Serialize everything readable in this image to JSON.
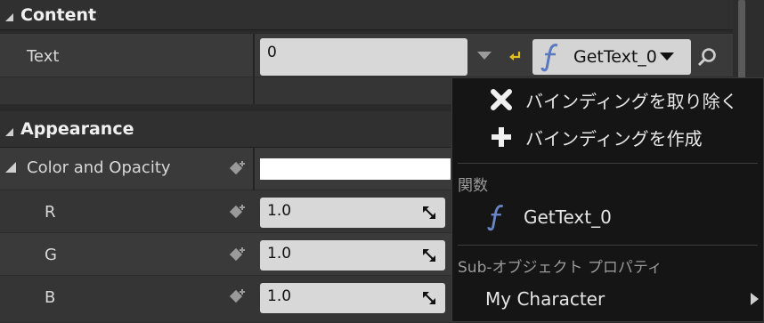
{
  "content": {
    "header": "Content",
    "text_row": {
      "label": "Text",
      "value": "0",
      "binding_button_label": "GetText_0"
    }
  },
  "appearance": {
    "header": "Appearance",
    "color_row": {
      "label": "Color and Opacity"
    },
    "r_row": {
      "label": "R",
      "value": "1.0"
    },
    "g_row": {
      "label": "G",
      "value": "1.0"
    },
    "b_row": {
      "label": "B",
      "value": "1.0"
    }
  },
  "menu": {
    "remove_binding": "バインディングを取り除く",
    "create_binding": "バインディングを作成",
    "functions_heading": "関数",
    "function_item": "GetText_0",
    "subobject_heading": "Sub-オブジェクト プロパティ",
    "subobject_item": "My Character"
  },
  "colors": {
    "panel_bg": "#2a2a2a",
    "field_bg": "#d8d8d8",
    "menu_bg": "#151515",
    "reset_arrow": "#e0c020",
    "function_icon": "#6a86c8"
  }
}
